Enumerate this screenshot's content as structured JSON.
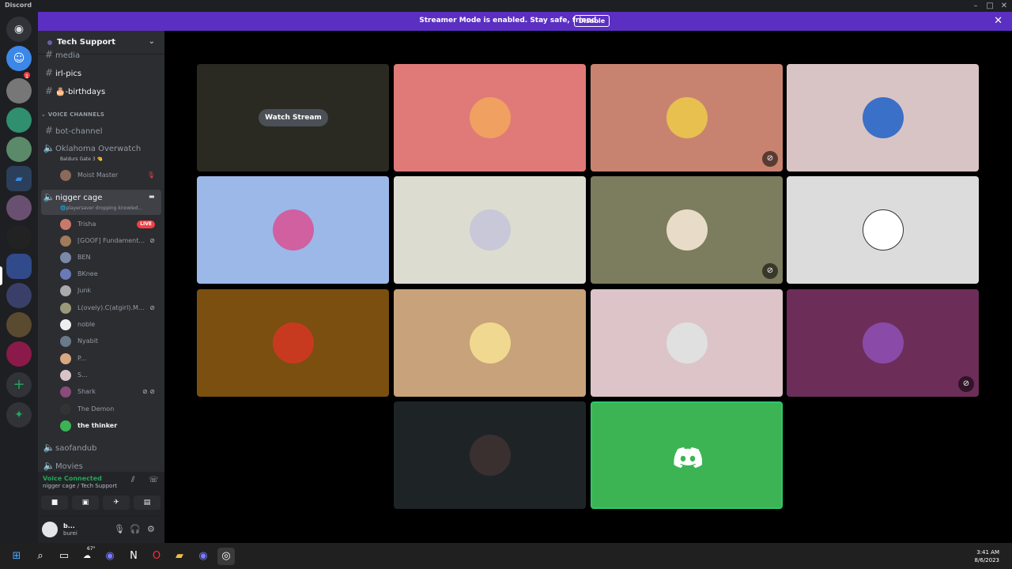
{
  "window": {
    "app_name": "Discord"
  },
  "banner": {
    "message": "Streamer Mode is enabled. Stay safe, friend.",
    "disable_label": "Disable"
  },
  "server": {
    "name": "Tech Support"
  },
  "channels": {
    "media": "media",
    "irl_pics": "irl-pics",
    "birthdays": "🎂-birthdays",
    "voice_category": "VOICE CHANNELS",
    "bot_channel": "bot-channel",
    "oklahoma": "Oklahoma Overwatch",
    "oklahoma_activity": "Baldurs Gate 3 🤏",
    "moist": "Moist Master",
    "nigger_cage": "nigger cage",
    "nigger_cage_status": "🌐playersaver dropping knowled...",
    "saofandub": "saofandub",
    "movies": "Movies"
  },
  "voice_users": [
    {
      "name": "Trisha",
      "live": "LIVE"
    },
    {
      "name": "[GOOF] Fundament..."
    },
    {
      "name": "BEN"
    },
    {
      "name": "BKnee"
    },
    {
      "name": "Junk"
    },
    {
      "name": "L(ovely).C(atgirl).M..."
    },
    {
      "name": "noble"
    },
    {
      "name": "Nyabit"
    },
    {
      "name": "P..."
    },
    {
      "name": "S..."
    },
    {
      "name": "Shark"
    },
    {
      "name": "The Demon"
    },
    {
      "name": "the thinker"
    }
  ],
  "voice_panel": {
    "status": "Voice Connected",
    "location": "nigger cage / Tech Support"
  },
  "user_panel": {
    "name": "b...",
    "status": "burei"
  },
  "grid": {
    "watch_stream_label": "Watch Stream",
    "tile_colors": [
      "#2a2a22",
      "#e07a78",
      "#c88370",
      "#d8c4c4",
      "#9bb8e8",
      "#dcdcd0",
      "#7c7c5e",
      "#dcdcdc",
      "#7a4f10",
      "#c8a27a",
      "#dcc4c8",
      "#6c2e58",
      "#1e2426",
      "#3cb454"
    ]
  },
  "taskbar": {
    "time": "3:41 AM",
    "date": "8/6/2023",
    "weather": "67°"
  }
}
